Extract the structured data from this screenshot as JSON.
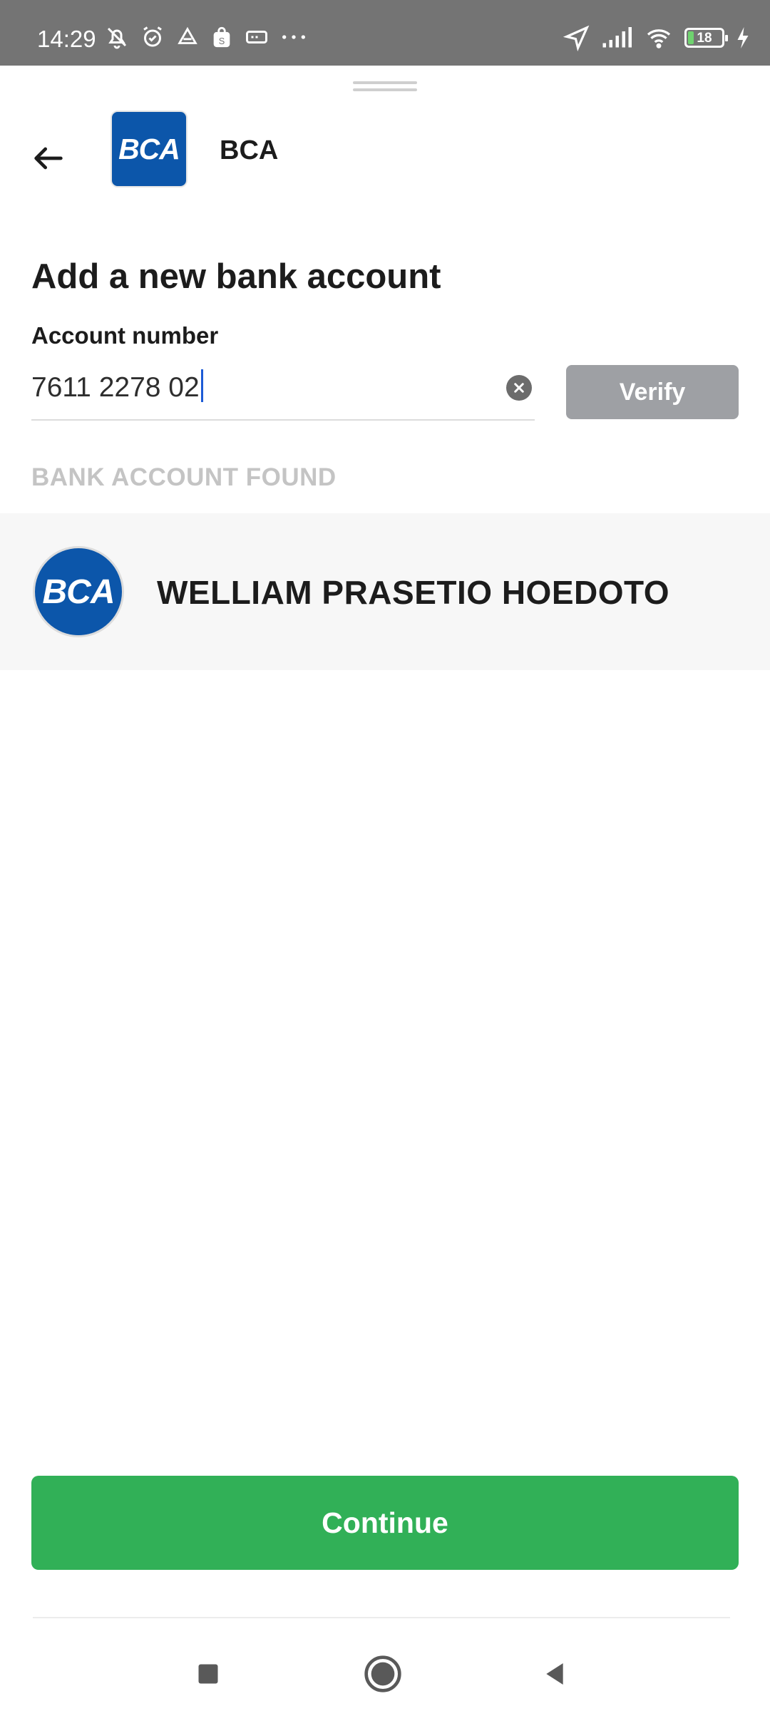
{
  "status_bar": {
    "time": "14:29",
    "battery_level": "18",
    "battery_fraction": 0.18,
    "icons_left": [
      "bell-off-icon",
      "alarm-icon",
      "drive-icon",
      "shopping-bag-icon",
      "card-icon",
      "more-dots-icon"
    ],
    "icons_right": [
      "location-arrow-icon",
      "signal-icon",
      "wifi-icon",
      "battery-icon",
      "charging-icon"
    ]
  },
  "header": {
    "bank_logo_text": "BCA",
    "bank_name": "BCA"
  },
  "form": {
    "title": "Add a new bank account",
    "account_label": "Account number",
    "account_value": "7611 2278 02",
    "verify_label": "Verify"
  },
  "result": {
    "section_header": "BANK ACCOUNT FOUND",
    "bank_logo_text": "BCA",
    "holder_name": "WELLIAM PRASETIO HOEDOTO"
  },
  "footer": {
    "continue_label": "Continue"
  },
  "colors": {
    "status_bar": "#747474",
    "bank_blue": "#0c56aa",
    "verify_disabled": "#9ea0a4",
    "continue_green": "#31b057",
    "section_header": "#c4c4c4"
  }
}
